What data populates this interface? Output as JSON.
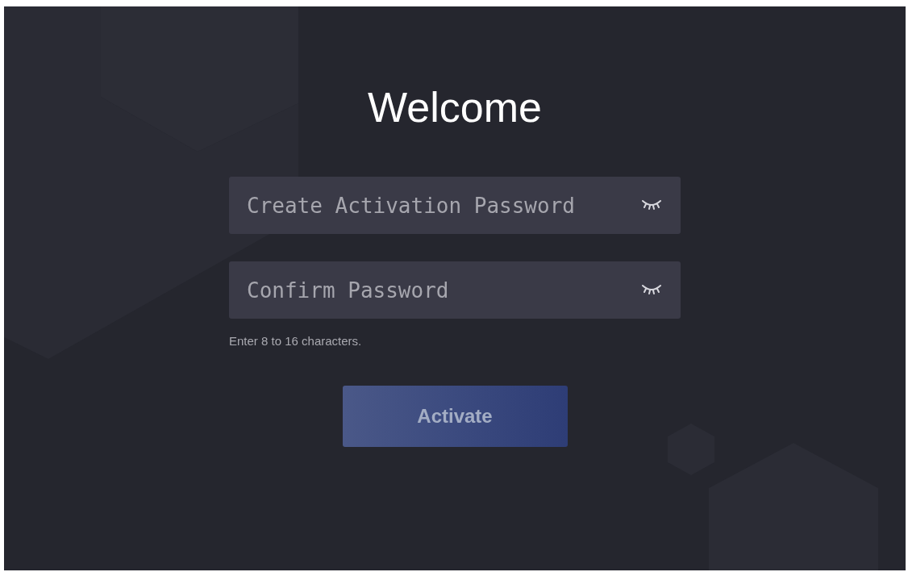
{
  "title": "Welcome",
  "fields": [
    {
      "placeholder": "Create Activation Password",
      "revealed": false
    },
    {
      "placeholder": "Confirm Password",
      "revealed": false
    }
  ],
  "hint": "Enter 8 to 16 characters.",
  "button": {
    "label": "Activate",
    "disabled": true
  }
}
